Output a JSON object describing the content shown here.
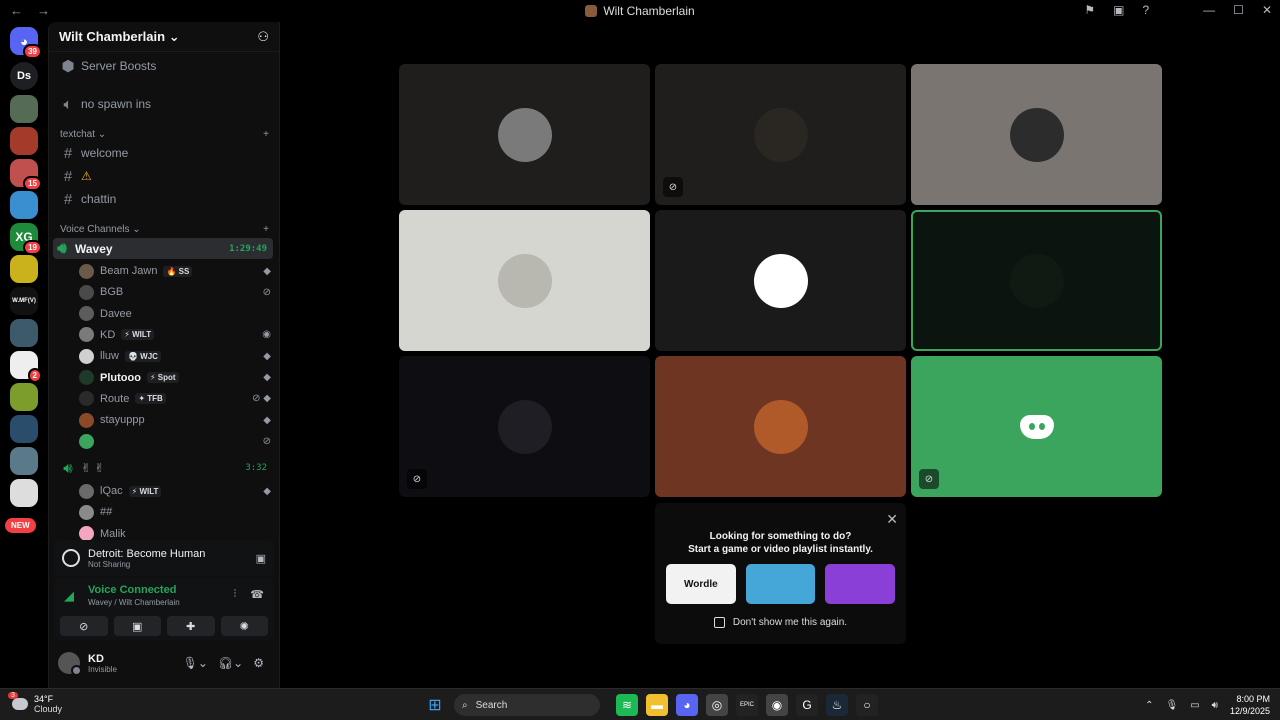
{
  "window": {
    "title": "Wilt Chamberlain",
    "back_glyph": "←",
    "forward_glyph": "→",
    "controls": [
      "⚑",
      "▣",
      "?",
      "—",
      "☐",
      "✕"
    ]
  },
  "rail": {
    "home_badge": "39",
    "dm_label": "Ds",
    "servers": [
      {
        "label": "",
        "color": "#556b55",
        "badge": ""
      },
      {
        "label": "",
        "color": "#a33a2a",
        "badge": ""
      },
      {
        "label": "",
        "color": "#c0504d",
        "badge": "15"
      },
      {
        "label": "",
        "color": "#3a8fd0",
        "badge": ""
      },
      {
        "label": "XG",
        "color": "#1e8b3a",
        "badge": "19"
      },
      {
        "label": "",
        "color": "#c9b21c",
        "badge": ""
      },
      {
        "label": "W.MF(V)",
        "color": "#111111",
        "badge": ""
      },
      {
        "label": "",
        "color": "#3d5a6b",
        "badge": ""
      },
      {
        "label": "",
        "color": "#eeeeee",
        "badge": "2"
      },
      {
        "label": "",
        "color": "#7c9c2c",
        "badge": ""
      },
      {
        "label": "",
        "color": "#2a4d6b",
        "badge": ""
      },
      {
        "label": "",
        "color": "#5a7a8a",
        "badge": ""
      },
      {
        "label": "",
        "color": "#dddddd",
        "badge": ""
      }
    ],
    "new_label": "NEW"
  },
  "server": {
    "name": "Wilt Chamberlain",
    "boosts_label": "Server Boosts",
    "no_spawn_label": "no spawn ins",
    "textchat_category": "textchat",
    "text_channels": [
      "welcome",
      "⚠",
      "chattin"
    ],
    "voice_category": "Voice Channels",
    "voice_channel_1": "Wavey",
    "voice_channel_1_timer": "1:29:49",
    "voice_users_1": [
      {
        "name": "Beam Jawn",
        "tag": "SS",
        "tag_icon": "🔥",
        "avatar": "#6b5a4a",
        "icons": "◆",
        "bold": false
      },
      {
        "name": "BGB",
        "tag": "",
        "tag_icon": "",
        "avatar": "#4a4a4a",
        "icons": "⊘",
        "bold": false
      },
      {
        "name": "Davee",
        "tag": "",
        "tag_icon": "",
        "avatar": "#5c5c5c",
        "icons": "",
        "bold": false
      },
      {
        "name": "KD",
        "tag": "WILT",
        "tag_icon": "⚡",
        "avatar": "#7a7a7a",
        "icons": "◉",
        "bold": false
      },
      {
        "name": "lluw",
        "tag": "WJC",
        "tag_icon": "💀",
        "avatar": "#d0d0d0",
        "icons": "◆",
        "bold": false
      },
      {
        "name": "Plutooo",
        "tag": "Spot",
        "tag_icon": "⚡",
        "avatar": "#1e3a2a",
        "icons": "◆",
        "bold": true
      },
      {
        "name": "Route",
        "tag": "TFB",
        "tag_icon": "✦",
        "avatar": "#2a2a2a",
        "icons": "⊘ ◆",
        "bold": false
      },
      {
        "name": "stayuppp",
        "tag": "",
        "tag_icon": "",
        "avatar": "#8a4a2a",
        "icons": "◆",
        "bold": false
      },
      {
        "name": "",
        "tag": "",
        "tag_icon": "",
        "avatar": "#3ba55d",
        "icons": "⊘",
        "bold": false
      }
    ],
    "voice_channel_2": "✌ ✌",
    "voice_channel_2_timer": "3:32",
    "voice_users_2": [
      {
        "name": "lQac",
        "tag": "WILT",
        "tag_icon": "⚡",
        "avatar": "#6a6a6a",
        "icons": "◆",
        "bold": false
      },
      {
        "name": "##",
        "tag": "",
        "tag_icon": "",
        "avatar": "#8a8a8a",
        "icons": "",
        "bold": false
      },
      {
        "name": "Malik",
        "tag": "",
        "tag_icon": "",
        "avatar": "#f4a6c0",
        "icons": "",
        "bold": false
      }
    ]
  },
  "activity": {
    "game": "Detroit: Become Human",
    "status": "Not Sharing"
  },
  "voice": {
    "status": "Voice Connected",
    "location": "Wavey / Wilt Chamberlain"
  },
  "user": {
    "name": "KD",
    "status": "Invisible"
  },
  "tiles": [
    {
      "bg": "#1f1e1c",
      "avatar": "#7a7a7a",
      "muted": false,
      "speaking": false,
      "logo": false
    },
    {
      "bg": "#1f1e1c",
      "avatar": "#2a2622",
      "muted": true,
      "speaking": false,
      "logo": false
    },
    {
      "bg": "#7a7570",
      "avatar": "#2c2c2c",
      "muted": false,
      "speaking": false,
      "logo": false
    },
    {
      "bg": "#d6d6d0",
      "avatar": "#b8b8b0",
      "muted": false,
      "speaking": false,
      "logo": false
    },
    {
      "bg": "#1a1a1a",
      "avatar": "#ffffff",
      "muted": false,
      "speaking": false,
      "logo": false
    },
    {
      "bg": "#0c140f",
      "avatar": "#0f1a12",
      "muted": false,
      "speaking": true,
      "logo": false
    },
    {
      "bg": "#0d0d12",
      "avatar": "#1e1e24",
      "muted": true,
      "speaking": false,
      "logo": false
    },
    {
      "bg": "#6e3522",
      "avatar": "#b05a2a",
      "muted": false,
      "speaking": false,
      "logo": false
    },
    {
      "bg": "#3ba55d",
      "avatar": "",
      "muted": true,
      "speaking": false,
      "logo": true
    }
  ],
  "prompt": {
    "line1": "Looking for something to do?",
    "line2": "Start a game or video playlist instantly.",
    "games": [
      {
        "label": "Wordle",
        "bg": "#f2f2f2",
        "fg": "#111111"
      },
      {
        "label": "",
        "bg": "#45a6d8",
        "fg": "#ffffff"
      },
      {
        "label": "",
        "bg": "#8a3fd6",
        "fg": "#ffffff"
      }
    ],
    "dont_show": "Don't show me this again."
  },
  "taskbar": {
    "weather_badge": "3",
    "temp": "34°F",
    "condition": "Cloudy",
    "search_label": "Search",
    "time": "8:00 PM",
    "date": "12/9/2025",
    "apps": [
      {
        "name": "spotify",
        "color": "#1db954",
        "glyph": "≋"
      },
      {
        "name": "file-explorer",
        "color": "#f0c030",
        "glyph": "▬"
      },
      {
        "name": "discord",
        "color": "#5865f2",
        "glyph": "◕"
      },
      {
        "name": "app",
        "color": "#444444",
        "glyph": "◎"
      },
      {
        "name": "epic",
        "color": "#222222",
        "glyph": "EPIC"
      },
      {
        "name": "chrome",
        "color": "#444444",
        "glyph": "◉"
      },
      {
        "name": "g-hub",
        "color": "#222222",
        "glyph": "G"
      },
      {
        "name": "steam",
        "color": "#1b2838",
        "glyph": "♨"
      },
      {
        "name": "circle-app",
        "color": "#222222",
        "glyph": "○"
      }
    ]
  }
}
